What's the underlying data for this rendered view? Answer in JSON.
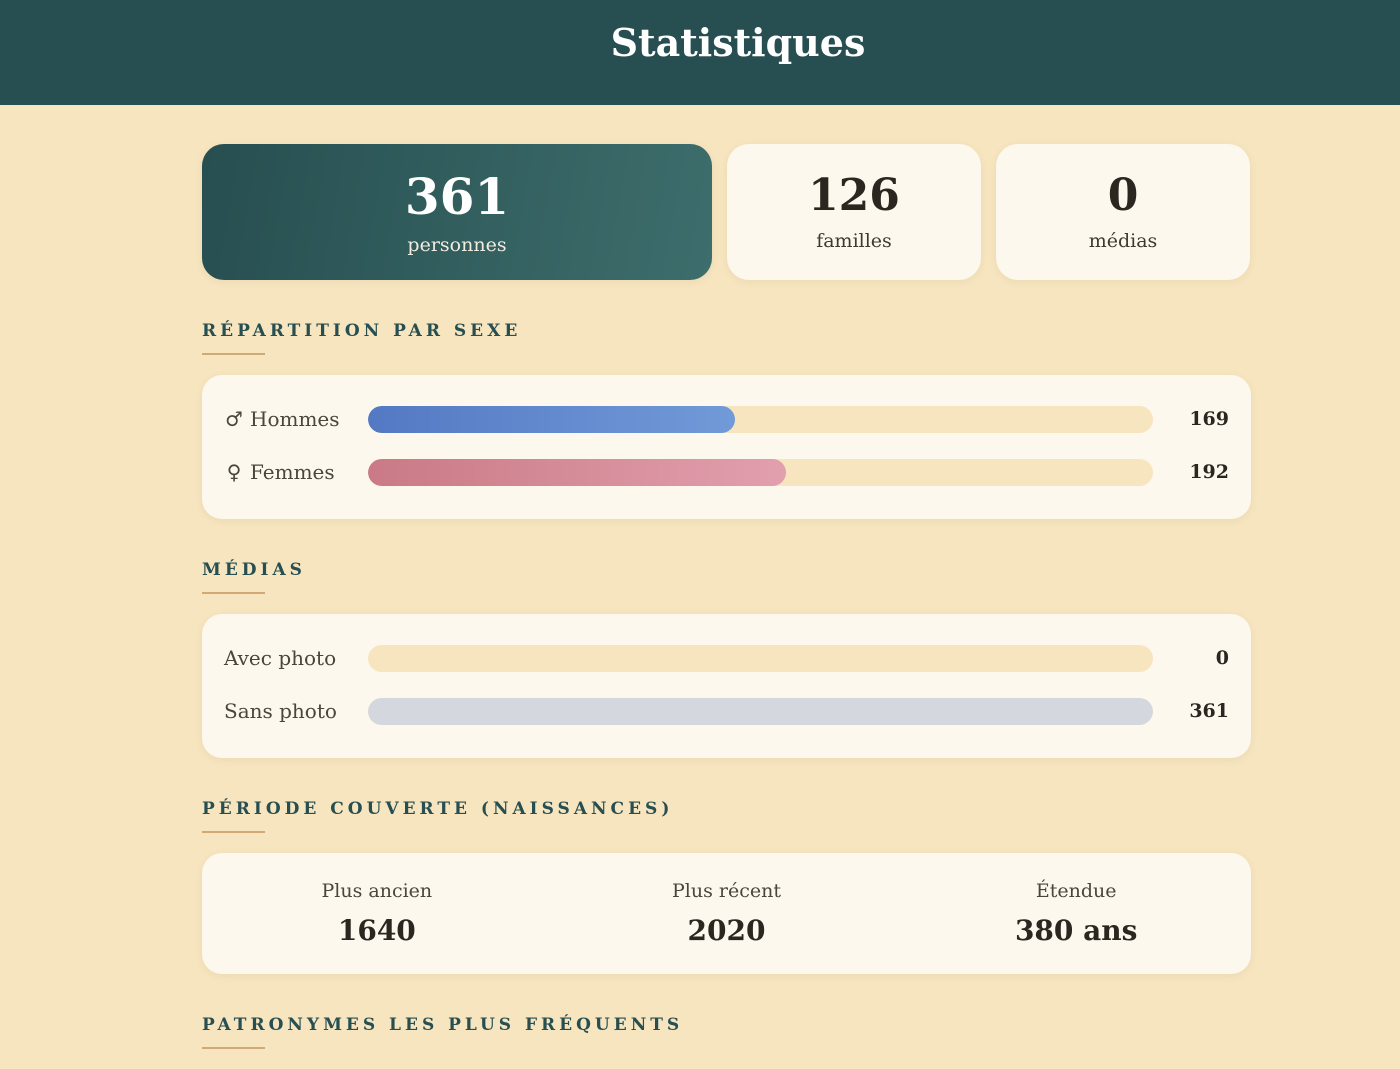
{
  "header": {
    "title": "Statistiques"
  },
  "summary": [
    {
      "value": "361",
      "label": "personnes"
    },
    {
      "value": "126",
      "label": "familles"
    },
    {
      "value": "0",
      "label": "médias"
    }
  ],
  "sex": {
    "title": "RÉPARTITION PAR SEXE",
    "rows": [
      {
        "icon": "male-icon",
        "symbol": "♂",
        "label": "Hommes",
        "count": "169",
        "fraction": 0.468,
        "colors": [
          "#5479c4",
          "#719ad8"
        ]
      },
      {
        "icon": "female-icon",
        "symbol": "♀",
        "label": "Femmes",
        "count": "192",
        "fraction": 0.532,
        "colors": [
          "#c97a85",
          "#e29fae"
        ]
      }
    ]
  },
  "media": {
    "title": "MÉDIAS",
    "rows": [
      {
        "label": "Avec photo",
        "count": "0",
        "fraction": 0,
        "color": "#dbe0e6"
      },
      {
        "label": "Sans photo",
        "count": "361",
        "fraction": 1,
        "color": "#d4d7de"
      }
    ]
  },
  "period": {
    "title": "PÉRIODE COUVERTE (NAISSANCES)",
    "oldest": {
      "label": "Plus ancien",
      "value": "1640"
    },
    "newest": {
      "label": "Plus récent",
      "value": "2020"
    },
    "span": {
      "label": "Étendue",
      "value": "380 ans"
    }
  },
  "surnames": {
    "title": "PATRONYMES LES PLUS FRÉQUENTS"
  }
}
